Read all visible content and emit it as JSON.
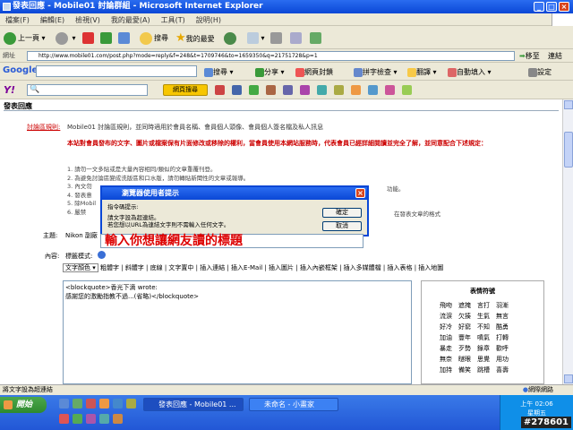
{
  "window": {
    "title": "發表回應 - Mobile01 討論群組 - Microsoft Internet Explorer"
  },
  "menu": [
    "檔案(F)",
    "編輯(E)",
    "檢視(V)",
    "我的最愛(A)",
    "工具(T)",
    "說明(H)"
  ],
  "toolbar": {
    "back": "上一頁",
    "search": "搜尋",
    "favorites": "我的最愛"
  },
  "address": {
    "url": "http://www.mobile01.com/post.php?mode=reply&f=248&t=1709746&to=1659350&q=21751728&p=1",
    "go": "移至",
    "links": "連結"
  },
  "google": {
    "brand": "Google",
    "search": "搜尋",
    "share": "分享",
    "pagerank": "網頁封鎖",
    "spell": "拼字檢查",
    "translate": "翻譯",
    "autofill": "自動填入",
    "settings": "設定"
  },
  "yahoo": {
    "search_button": "網頁搜尋"
  },
  "page": {
    "heading": "發表回應",
    "rules_label": "討論區規則:",
    "rules_intro": "Mobile01 討論區規則，並同時適用於會員名稱、會員個人頭像、會員個人簽名檔及私人訊息",
    "rules_red": "本站對會員發布的文字、圖片或檔案保有片面修改或移除的權利，當會員使用本網站服務時，代表會員已經詳細閱讀並完全了解，並同意配合下述規定：",
    "rules": [
      "1. 請勿一文多貼或是大量內容相同/類似的文章重覆刊登。",
      "2. 為避免討論區變成洗版區和口水版，請勿轉貼新聞性的文章或報導。",
      "3. 內文勿",
      "4. 發表意",
      "5. 除Mobil",
      "6. 嚴禁"
    ],
    "rules_tail3": "功能。",
    "rules_tail6": "在發表文章的格式",
    "subject_label": "主題:",
    "subject_value": "Nikon 副廠",
    "content_label": "內容:",
    "mode_label": "標籤模式:",
    "text_color": "文字顏色",
    "format_buttons": [
      "粗體字",
      "斜體字",
      "底線",
      "文字置中",
      "插入連結",
      "插入E-Mail",
      "插入圖片",
      "插入內嵌框架",
      "插入多媒體檔",
      "插入表格",
      "插入地圖"
    ],
    "editor_lines": [
      "<blockquote>香光下滴 wrote:",
      "感謝您的激勵指教不過...(省略)</blockquote>"
    ],
    "emoticon_title": "表情符號",
    "emoticons": [
      [
        "飛吻",
        "遮掩",
        "言打",
        "羽漸"
      ],
      [
        "流淚",
        "欠揍",
        "生氣",
        "無言"
      ],
      [
        "好冷",
        "好窮",
        "不知",
        "酷勇"
      ],
      [
        "加油",
        "豐年",
        "噴氣",
        "打轉"
      ],
      [
        "暴走",
        "歹勢",
        "錄章",
        "歡呼"
      ],
      [
        "無奈",
        "瞇眼",
        "思覺",
        "用功"
      ],
      [
        "加持",
        "備笑",
        "跳槽",
        "喜壽"
      ]
    ]
  },
  "dialog": {
    "title": "瀏覽器使用者提示",
    "prompt_label": "指令碼提示:",
    "prompt_lines": [
      "請文字設為超連結。",
      "若您想以URL為連結文字則不需輸入任何文字。"
    ],
    "ok": "確定",
    "cancel": "取消",
    "input_value": "輸入你想讓網友讀的標題"
  },
  "status": {
    "left": "將文字設為超連結",
    "zone": "網際網路"
  },
  "taskbar": {
    "start": "開始",
    "tasks": [
      "發表回應 - Mobile01 ...",
      "未命名 - 小畫家"
    ],
    "time": "上午 02:06",
    "day": "星期五"
  },
  "watermark": "#278601"
}
